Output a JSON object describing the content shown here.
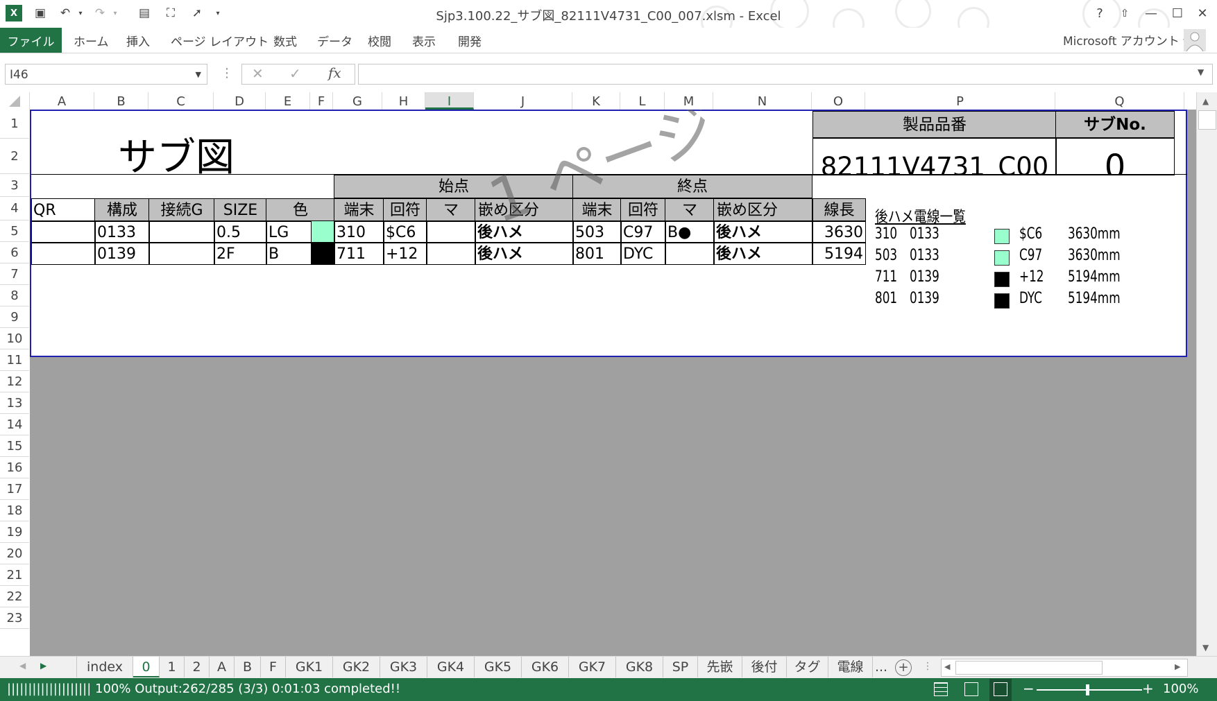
{
  "window": {
    "title": "Sjp3.100.22_サブ図_82111V4731_C00_007.xlsm - Excel",
    "help": "?",
    "min": "—",
    "max": "☐",
    "close": "✕"
  },
  "ribbon": {
    "file": "ファイル",
    "tabs": [
      "ホーム",
      "挿入",
      "ページ レイアウト",
      "数式",
      "データ",
      "校閲",
      "表示",
      "開発"
    ],
    "account": "Microsoft アカウント ▾"
  },
  "formula_bar": {
    "name_box": "I46",
    "formula": ""
  },
  "columns": [
    "A",
    "B",
    "C",
    "D",
    "E",
    "F",
    "G",
    "H",
    "I",
    "J",
    "K",
    "L",
    "M",
    "N",
    "O",
    "P",
    "Q"
  ],
  "selected_column": "I",
  "rows": [
    "1",
    "2",
    "3",
    "4",
    "5",
    "6",
    "7",
    "8",
    "9",
    "10",
    "11",
    "12",
    "13",
    "14",
    "15",
    "16",
    "17",
    "18",
    "19",
    "20",
    "21",
    "22",
    "23"
  ],
  "sheet": {
    "title": "サブ図",
    "product_label": "製品品番",
    "sub_no_label": "サブNo.",
    "product_value": "82111V4731_C00",
    "sub_no_value": "0",
    "watermark": "1 ページ",
    "start_group": "始点",
    "end_group": "終点",
    "headers": [
      "QR",
      "構成",
      "接続G",
      "SIZE",
      "色",
      "端末",
      "回符",
      "マ",
      "嵌め区分",
      "端末",
      "回符",
      "マ",
      "嵌め区分",
      "線長"
    ],
    "rows": [
      {
        "qr": "",
        "kousei": "0133",
        "setsuzoku": "",
        "size": "0.5",
        "color": "LG",
        "color_hex": "#99ffcc",
        "s_tanmatsu": "310",
        "s_kaifu": "$C6",
        "s_ma": "",
        "s_hame": "後ハメ",
        "e_tanmatsu": "503",
        "e_kaifu": "C97",
        "e_ma": "B●",
        "e_hame": "後ハメ",
        "length": "3630"
      },
      {
        "qr": "",
        "kousei": "0139",
        "setsuzoku": "",
        "size": "2F",
        "color": "B",
        "color_hex": "#000000",
        "s_tanmatsu": "711",
        "s_kaifu": "+12",
        "s_ma": "",
        "s_hame": "後ハメ",
        "e_tanmatsu": "801",
        "e_kaifu": "DYC",
        "e_ma": "",
        "e_hame": "後ハメ",
        "length": "5194"
      }
    ],
    "list_title": "後ハメ電線一覧",
    "list": [
      {
        "tanmatsu": "310",
        "kousei": "0133",
        "swatch": "#99ffcc",
        "kaifu": "$C6",
        "length": "3630mm"
      },
      {
        "tanmatsu": "503",
        "kousei": "0133",
        "swatch": "#99ffcc",
        "kaifu": "C97",
        "length": "3630mm"
      },
      {
        "tanmatsu": "711",
        "kousei": "0139",
        "swatch": "#000000",
        "kaifu": "+12",
        "length": "5194mm"
      },
      {
        "tanmatsu": "801",
        "kousei": "0139",
        "swatch": "#000000",
        "kaifu": "DYC",
        "length": "5194mm"
      }
    ]
  },
  "sheet_tabs": [
    "index",
    "0",
    "1",
    "2",
    "A",
    "B",
    "F",
    "GK1",
    "GK2",
    "GK3",
    "GK4",
    "GK5",
    "GK6",
    "GK7",
    "GK8",
    "SP",
    "先嵌",
    "後付",
    "タグ",
    "電線",
    "..."
  ],
  "active_tab": "0",
  "status": {
    "text": "|||||||||||||||||||| 100% Output:262/285  (3/3)  0:01:03 completed!!",
    "zoom": "100%"
  },
  "colors": {
    "accent": "#217346",
    "grid_gray": "#a0a0a0",
    "header_gray": "#c0c0c0",
    "print_border": "#1f1fb0"
  }
}
